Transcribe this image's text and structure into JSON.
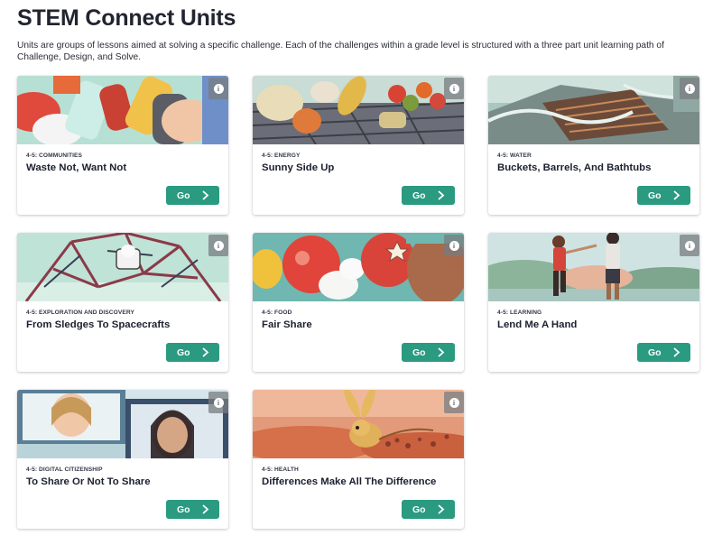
{
  "header": {
    "title": "STEM Connect Units",
    "description": "Units are groups of lessons aimed at solving a specific challenge. Each of the challenges within a grade level is structured with a three part unit learning path of Challenge, Design, and Solve."
  },
  "cards": [
    {
      "category": "4-5: COMMUNITIES",
      "title": "Waste Not, Want Not",
      "go_label": "Go",
      "info_icon": "info-icon",
      "image": "cans and bottles illustration"
    },
    {
      "category": "4-5: ENERGY",
      "title": "Sunny Side Up",
      "go_label": "Go",
      "info_icon": "info-icon",
      "image": "grilled food illustration"
    },
    {
      "category": "4-5: WATER",
      "title": "Buckets, Barrels, And Bathtubs",
      "go_label": "Go",
      "info_icon": "info-icon",
      "image": "storm drain illustration"
    },
    {
      "category": "4-5: EXPLORATION AND DISCOVERY",
      "title": "From Sledges To Spacecrafts",
      "go_label": "Go",
      "info_icon": "info-icon",
      "image": "geodesic structure illustration"
    },
    {
      "category": "4-5: FOOD",
      "title": "Fair Share",
      "go_label": "Go",
      "info_icon": "info-icon",
      "image": "fruit illustration"
    },
    {
      "category": "4-5: LEARNING",
      "title": "Lend Me A Hand",
      "go_label": "Go",
      "info_icon": "info-icon",
      "image": "children holding hands illustration"
    },
    {
      "category": "4-5: DIGITAL CITIZENSHIP",
      "title": "To Share Or Not To Share",
      "go_label": "Go",
      "info_icon": "info-icon",
      "image": "girls on screens illustration"
    },
    {
      "category": "4-5: HEALTH",
      "title": "Differences Make All The Difference",
      "go_label": "Go",
      "info_icon": "info-icon",
      "image": "jerboa in desert illustration"
    }
  ],
  "colors": {
    "go_button": "#2a9a80",
    "title_text": "#22252f"
  }
}
